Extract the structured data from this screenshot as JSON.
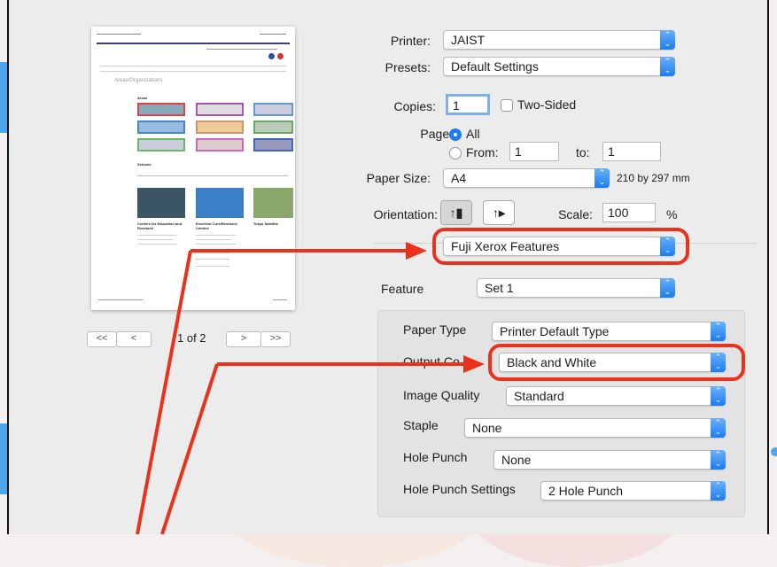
{
  "printer": {
    "label": "Printer:",
    "value": "JAIST"
  },
  "presets": {
    "label": "Presets:",
    "value": "Default Settings"
  },
  "copies": {
    "label": "Copies:",
    "value": "1",
    "two_sided_label": "Two-Sided"
  },
  "pages": {
    "label": "Pages:",
    "all_label": "All",
    "from_label": "From:",
    "from_value": "1",
    "to_label": "to:",
    "to_value": "1"
  },
  "paper_size": {
    "label": "Paper Size:",
    "value": "A4",
    "dimensions": "210 by 297 mm"
  },
  "orientation": {
    "label": "Orientation:"
  },
  "scale": {
    "label": "Scale:",
    "value": "100",
    "unit": "%"
  },
  "section_menu": {
    "value": "Fuji Xerox Features"
  },
  "feature": {
    "label": "Feature",
    "value": "Set 1"
  },
  "paper_type": {
    "label": "Paper Type",
    "value": "Printer Default Type"
  },
  "output_color": {
    "label": "Output Co",
    "value": "Black and White"
  },
  "image_quality": {
    "label": "Image Quality",
    "value": "Standard"
  },
  "staple": {
    "label": "Staple",
    "value": "None"
  },
  "hole_punch": {
    "label": "Hole Punch",
    "value": "None"
  },
  "hole_punch_settings": {
    "label": "Hole Punch Settings",
    "value": "2 Hole Punch"
  },
  "preview_nav": {
    "first": "<<",
    "prev": "<",
    "page_info": "1 of 2",
    "next": ">",
    "last": ">>"
  },
  "preview_page": {
    "heading": "Areas/Organizations",
    "areas_label": "Areas",
    "schools_label": "Schools",
    "center1": "Centers for Education and Research",
    "center2": "Excellent Core/Research Centers",
    "center3": "Tokyo Satellite"
  },
  "colors": {
    "accent": "#1c7cf0",
    "callout": "#e8321c",
    "outer_arrow": "#4da6ee"
  }
}
